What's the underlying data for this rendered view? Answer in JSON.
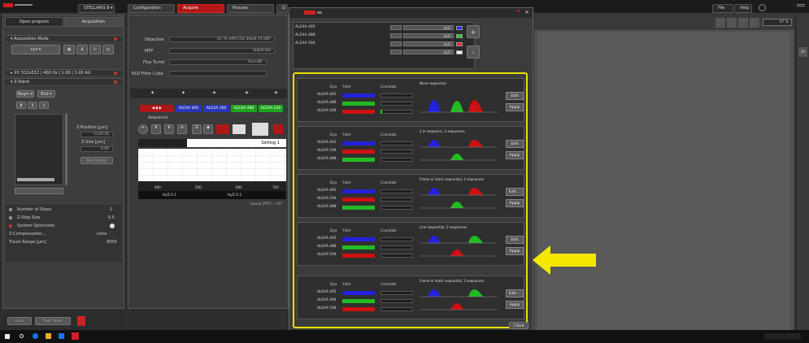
{
  "topbar": {
    "dropdown": "STELLARIS 8",
    "tabs": [
      "Configuration",
      "Acquire",
      "Process",
      "Q"
    ],
    "right_menu": [
      "File",
      "Help"
    ]
  },
  "left": {
    "tabs": [
      "Open projects",
      "Acquisition"
    ],
    "acq_mode_label": "Acquisition Mode",
    "acq_mode_value": "xyz",
    "xy_label": "XY: 512x512 | 400 Hz | 1.00 | 1.00 AU",
    "zstack_label": "Z-Stack",
    "begin": "Begin",
    "end": "End",
    "zpos_label": "Z-Position [µm]",
    "zpos_value": "1129.58",
    "zsize_label": "Z-Size [µm]",
    "zsize_value": "0.00",
    "recenter": "Re-Center",
    "settings": [
      {
        "label": "Number of Steps",
        "value": "1"
      },
      {
        "label": "Z-Step Size",
        "value": "0.5"
      },
      {
        "label": "System Optimized",
        "value": ""
      },
      {
        "label": "Z-Compensation...",
        "value": "none"
      },
      {
        "label": "Travel Range [µm]",
        "value": "8000"
      }
    ],
    "bottom_buttons": [
      "Live",
      "Fast Scan"
    ]
  },
  "mid": {
    "objective_label": "Objective",
    "objective_value": "HC PL APO CS2 20x/0.75 DRY",
    "mfp_label": "MFP",
    "mfp_value": "Substrate",
    "flux_label": "Flux Turret",
    "flux_value": "Scan-BF",
    "rld_label": "RLD Filter Cube",
    "channels": [
      "ALEXA 405",
      "ALEXA 350",
      "ALEXA 488",
      "ALEXA 430"
    ],
    "sequence": "Sequence",
    "setting": "Setting 1",
    "scale_labels": [
      "400",
      "500",
      "600",
      "700"
    ],
    "detectors": [
      "HyD S 1",
      "HyD X 2"
    ],
    "footer": "Sweep (PMT) → OFF"
  },
  "dialog": {
    "dyes": [
      {
        "name": "ALEXA 405",
        "detector": "HyD",
        "color": "#2222ee"
      },
      {
        "name": "ALEXA 488",
        "detector": "HyD",
        "color": "#22cc22"
      },
      {
        "name": "ALEXA 594",
        "detector": "HyD",
        "color": "#ee2222"
      },
      {
        "name": "",
        "detector": "HyD",
        "color": "#ffffff"
      }
    ],
    "options": [
      {
        "caption": "None sequential",
        "dyes": [
          "ALEXA 405",
          "ALEXA 488",
          "ALEXA 594"
        ],
        "colors": [
          "#2222dd",
          "#22bb22",
          "#cc1111"
        ],
        "xtalk_green": true,
        "buttons": [
          "Edit",
          "Apply"
        ]
      },
      {
        "caption": "2 in sequence, 2 sequences",
        "dyes": [
          "ALEXA 405",
          "ALEXA 594",
          "ALEXA 488"
        ],
        "colors": [
          "#2222dd",
          "#cc1111",
          "#22bb22"
        ],
        "xtalk_green": false,
        "buttons": [
          "Edit",
          "Apply"
        ]
      },
      {
        "caption": "Frame or stack sequential, 2 sequences",
        "dyes": [
          "ALEXA 405",
          "ALEXA 594",
          "ALEXA 488"
        ],
        "colors": [
          "#2222dd",
          "#cc1111",
          "#22bb22"
        ],
        "xtalk_green": false,
        "buttons": [
          "Edit ...",
          "Apply"
        ]
      },
      {
        "caption": "Line sequential, 3 sequences",
        "dyes": [
          "ALEXA 405",
          "ALEXA 488",
          "ALEXA 594"
        ],
        "colors": [
          "#2222dd",
          "#22bb22",
          "#cc1111"
        ],
        "xtalk_green": false,
        "buttons": [
          "Edit",
          "Apply"
        ]
      },
      {
        "caption": "Frame or stack sequential, 3 sequences",
        "dyes": [
          "ALEXA 405",
          "ALEXA 494",
          "ALEXA 594"
        ],
        "colors": [
          "#2222dd",
          "#22bb22",
          "#cc1111"
        ],
        "xtalk_green": false,
        "buttons": [
          "Edit ...",
          "Apply"
        ]
      }
    ],
    "headers": {
      "dye": "Dye",
      "yield": "Yield",
      "crosstalk": "Crosstalk"
    },
    "close": "Close",
    "plus": "+",
    "minus": "-"
  },
  "right": {
    "zoom": "97 %"
  },
  "annotation": {
    "arrow_color": "#f5e800"
  }
}
